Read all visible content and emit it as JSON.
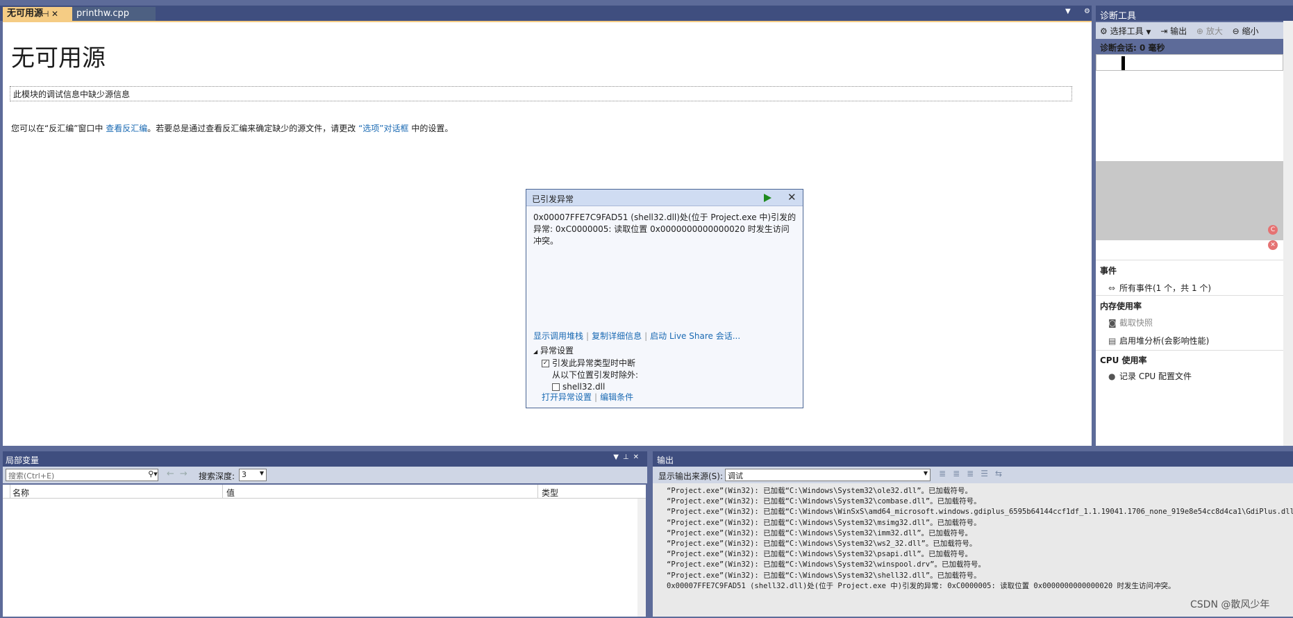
{
  "document_tabs": {
    "active": {
      "label": "无可用源",
      "pin_glyph": "⊣",
      "close_glyph": "✕"
    },
    "inactive": {
      "label": "printhw.cpp"
    }
  },
  "document": {
    "title": "无可用源",
    "info_box": "此模块的调试信息中缺少源信息",
    "help_prefix": "您可以在“反汇编”窗口中 ",
    "help_link1": "查看反汇编",
    "help_middle": "。若要总是通过查看反汇编来确定缺少的源文件，请更改 ",
    "help_link2": "“选项”对话框",
    "help_suffix": " 中的设置。"
  },
  "exception_popup": {
    "title": "已引发异常",
    "message": "0x00007FFE7C9FAD51 (shell32.dll)处(位于 Project.exe 中)引发的异常: 0xC0000005: 读取位置 0x0000000000000020 时发生访问冲突。",
    "link_callstack": "显示调用堆栈",
    "link_copy": "复制详细信息",
    "link_liveshare": "启动 Live Share 会话...",
    "settings_header": "异常设置",
    "break_checkbox_label": "引发此异常类型时中断",
    "except_from_label": "从以下位置引发时除外:",
    "module_checkbox_label": "shell32.dll",
    "break_checked": true,
    "module_checked": false,
    "link_open_settings": "打开异常设置",
    "link_edit_conditions": "编辑条件",
    "play_color": "#1e8a1e"
  },
  "diagnostics": {
    "title": "诊断工具",
    "toolbar": {
      "select_tools": "选择工具",
      "export": "输出",
      "zoom_in": "放大",
      "zoom_out": "缩小"
    },
    "session": "诊断会话: 0 毫秒",
    "events_title": "事件",
    "events_item": "所有事件(1 个，共 1 个)",
    "memory_title": "内存使用率",
    "memory_snapshot": "截取快照",
    "memory_heap": "启用堆分析(会影响性能)",
    "cpu_title": "CPU 使用率",
    "cpu_record": "记录 CPU 配置文件"
  },
  "locals": {
    "title": "局部变量",
    "search_placeholder": "搜索(Ctrl+E)",
    "depth_label": "搜索深度:",
    "depth_value": "3",
    "columns": [
      "名称",
      "值",
      "类型"
    ]
  },
  "output": {
    "title": "输出",
    "source_label": "显示输出来源(S):",
    "source_value": "调试",
    "lines": [
      "“Project.exe”(Win32): 已加载“C:\\Windows\\System32\\ole32.dll”。已加载符号。",
      "“Project.exe”(Win32): 已加载“C:\\Windows\\System32\\combase.dll”。已加载符号。",
      "“Project.exe”(Win32): 已加载“C:\\Windows\\WinSxS\\amd64_microsoft.windows.gdiplus_6595b64144ccf1df_1.1.19041.1706_none_919e8e54cc8d4ca1\\GdiPlus.dll”",
      "“Project.exe”(Win32): 已加载“C:\\Windows\\System32\\msimg32.dll”。已加载符号。",
      "“Project.exe”(Win32): 已加载“C:\\Windows\\System32\\imm32.dll”。已加载符号。",
      "“Project.exe”(Win32): 已加载“C:\\Windows\\System32\\ws2_32.dll”。已加载符号。",
      "“Project.exe”(Win32): 已加载“C:\\Windows\\System32\\psapi.dll”。已加载符号。",
      "“Project.exe”(Win32): 已加载“C:\\Windows\\System32\\winspool.drv”。已加载符号。",
      "“Project.exe”(Win32): 已加载“C:\\Windows\\System32\\shell32.dll”。已加载符号。",
      "0x00007FFE7C9FAD51 (shell32.dll)处(位于 Project.exe 中)引发的异常: 0xC0000005: 读取位置 0x0000000000000020 时发生访问冲突。"
    ]
  },
  "watermark": "CSDN @散风少年"
}
